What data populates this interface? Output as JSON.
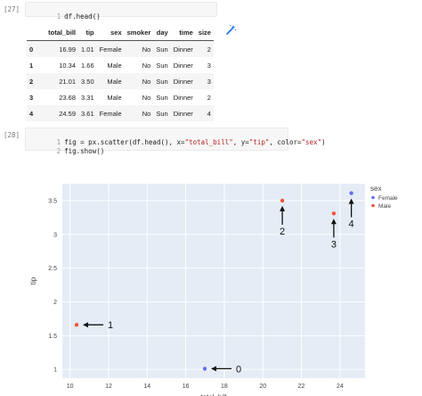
{
  "cell1": {
    "prompt": "[27]",
    "line_no": "1",
    "code": "df.head()"
  },
  "dataframe": {
    "columns": [
      "",
      "total_bill",
      "tip",
      "sex",
      "smoker",
      "day",
      "time",
      "size"
    ],
    "rows": [
      [
        "0",
        "16.99",
        "1.01",
        "Female",
        "No",
        "Sun",
        "Dinner",
        "2"
      ],
      [
        "1",
        "10.34",
        "1.66",
        "Male",
        "No",
        "Sun",
        "Dinner",
        "3"
      ],
      [
        "2",
        "21.01",
        "3.50",
        "Male",
        "No",
        "Sun",
        "Dinner",
        "3"
      ],
      [
        "3",
        "23.68",
        "3.31",
        "Male",
        "No",
        "Sun",
        "Dinner",
        "2"
      ],
      [
        "4",
        "24.59",
        "3.61",
        "Female",
        "No",
        "Sun",
        "Dinner",
        "4"
      ]
    ]
  },
  "cell2": {
    "prompt": "[28]",
    "lines": [
      {
        "no": "1",
        "pre": "fig = px.scatter(df.head(), x=",
        "s1": "\"total_bill\"",
        "mid1": ", y=",
        "s2": "\"tip\"",
        "mid2": ", color=",
        "s3": "\"sex\"",
        "post": ")"
      },
      {
        "no": "2",
        "pre": "fig.show()",
        "s1": "",
        "mid1": "",
        "s2": "",
        "mid2": "",
        "s3": "",
        "post": ""
      }
    ]
  },
  "chart_data": {
    "type": "scatter",
    "xlabel": "total_bill",
    "ylabel": "tip",
    "xlim": [
      9.6,
      25.3
    ],
    "ylim": [
      0.87,
      3.75
    ],
    "xticks": [
      10,
      12,
      14,
      16,
      18,
      20,
      22,
      24
    ],
    "yticks": [
      1,
      1.5,
      2,
      2.5,
      3,
      3.5
    ],
    "ytick_labels": [
      "1",
      "1.5",
      "2",
      "2.5",
      "3",
      "3.5"
    ],
    "legend_title": "sex",
    "legend_position": "right",
    "series": [
      {
        "name": "Female",
        "color": "#636efa",
        "x": [
          16.99,
          24.59
        ],
        "y": [
          1.01,
          3.61
        ]
      },
      {
        "name": "Male",
        "color": "#ef553b",
        "x": [
          10.34,
          21.01,
          23.68
        ],
        "y": [
          1.66,
          3.5,
          3.31
        ]
      }
    ],
    "annotations": [
      {
        "text": "0",
        "x": 16.99,
        "y": 1.01,
        "direction": "left"
      },
      {
        "text": "1",
        "x": 10.34,
        "y": 1.66,
        "direction": "left"
      },
      {
        "text": "2",
        "x": 21.01,
        "y": 3.5,
        "direction": "up"
      },
      {
        "text": "3",
        "x": 23.68,
        "y": 3.31,
        "direction": "up"
      },
      {
        "text": "4",
        "x": 24.59,
        "y": 3.61,
        "direction": "up"
      }
    ],
    "plot_background": "#e5ecf6",
    "grid": true
  }
}
